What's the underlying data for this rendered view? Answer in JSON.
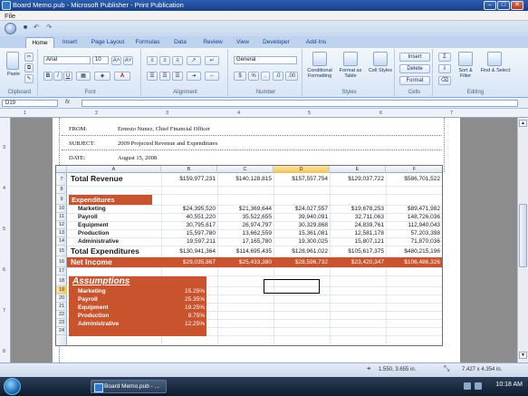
{
  "window": {
    "title": "Board Memo.pub - Microsoft Publisher - Print Publication",
    "min": "–",
    "max": "□",
    "close": "✕"
  },
  "menu": {
    "file": "File"
  },
  "qat": {
    "save": "■",
    "undo": "↶",
    "redo": "↷"
  },
  "ribbon_tabs": [
    "Home",
    "Insert",
    "Page Layout",
    "Formulas",
    "Data",
    "Review",
    "View",
    "Developer",
    "Add-Ins"
  ],
  "ribbon": {
    "clipboard": {
      "label": "Clipboard",
      "paste": "Paste"
    },
    "font": {
      "label": "Font",
      "name": "Arial",
      "size": "10",
      "grow": "A˄",
      "shrink": "A˅",
      "bold": "B",
      "italic": "I",
      "underline": "U",
      "color": "A"
    },
    "alignment": {
      "label": "Alignment"
    },
    "number": {
      "label": "Number",
      "format": "General",
      "currency": "$",
      "percent": "%",
      "comma": ",",
      "inc_dec": ".0",
      "dec_dec": ".00"
    },
    "styles": {
      "label": "Styles",
      "conditional": "Conditional Formatting",
      "format_table": "Format as Table",
      "cell_styles": "Cell Styles"
    },
    "cells": {
      "label": "Cells",
      "insert": "Insert",
      "delete": "Delete",
      "format": "Format"
    },
    "editing": {
      "label": "Editing",
      "sum": "Σ",
      "sort_filter": "Sort & Filter",
      "find_select": "Find & Select"
    }
  },
  "formula_bar": {
    "name_box": "D19",
    "fx": "fx",
    "value": ""
  },
  "ruler": {
    "top": [
      "1",
      "2",
      "3",
      "4",
      "5",
      "6",
      "7"
    ],
    "left": [
      "3",
      "4",
      "5",
      "6",
      "7",
      "8"
    ]
  },
  "memo": {
    "from_label": "FROM:",
    "from_value": "Ernesto Nunez, Chief Financial Officer",
    "subject_label": "SUBJECT:",
    "subject_value": "2009 Projected Revenue and Expenditures",
    "date_label": "DATE:",
    "date_value": "August 15, 2008"
  },
  "sheet": {
    "columns": [
      "A",
      "B",
      "C",
      "D",
      "E",
      "F"
    ],
    "rows": [
      "7",
      "8",
      "9",
      "10",
      "11",
      "12",
      "13",
      "14",
      "15",
      "16",
      "17",
      "18",
      "19",
      "20",
      "21",
      "22",
      "23",
      "24"
    ],
    "total_revenue": {
      "label": "Total Revenue",
      "values": [
        "$159,977,231",
        "$140,128,815",
        "$157,557,754",
        "$129,037,722",
        "$586,701,522"
      ]
    },
    "expenditures_header": "Expenditures",
    "expenditures": [
      {
        "label": "Marketing",
        "values": [
          "$24,395,520",
          "$21,369,644",
          "$24,027,557",
          "$19,678,253",
          "$89,471,982"
        ]
      },
      {
        "label": "Payroll",
        "values": [
          "40,551,220",
          "35,522,655",
          "39,940,091",
          "32,711,063",
          "148,726,036"
        ]
      },
      {
        "label": "Equipment",
        "values": [
          "30,795,617",
          "26,974,797",
          "30,329,868",
          "24,839,761",
          "112,940,043"
        ]
      },
      {
        "label": "Production",
        "values": [
          "15,597,780",
          "13,662,559",
          "15,361,081",
          "12,581,178",
          "57,203,398"
        ]
      },
      {
        "label": "Administrative",
        "values": [
          "19,597,211",
          "17,165,780",
          "19,300,025",
          "15,807,121",
          "71,870,036"
        ]
      }
    ],
    "total_expenditures": {
      "label": "Total Expenditures",
      "values": [
        "$130,941,364",
        "$114,695,435",
        "$128,961,022",
        "$105,617,375",
        "$480,215,196"
      ]
    },
    "net_income": {
      "label": "Net Income",
      "values": [
        "$29,035,867",
        "$25,433,380",
        "$28,596,732",
        "$23,420,347",
        "$106,486,326"
      ]
    },
    "assumptions_header": "Assumptions",
    "assumptions": [
      {
        "label": "Marketing",
        "value": "15.25%"
      },
      {
        "label": "Payroll",
        "value": "25.35%"
      },
      {
        "label": "Equipment",
        "value": "19.25%"
      },
      {
        "label": "Production",
        "value": "9.75%"
      },
      {
        "label": "Administrative",
        "value": "12.25%"
      }
    ]
  },
  "status": {
    "position": "1.550, 3.655 in.",
    "size": "7.427 x 4.354 in."
  },
  "taskbar": {
    "item": "Board Memo.pub - ...",
    "clock": "10:18 AM"
  },
  "colors": {
    "orange": "#c8532c",
    "title_blue": "#1f4e9e",
    "selection": "#f0c35a"
  }
}
